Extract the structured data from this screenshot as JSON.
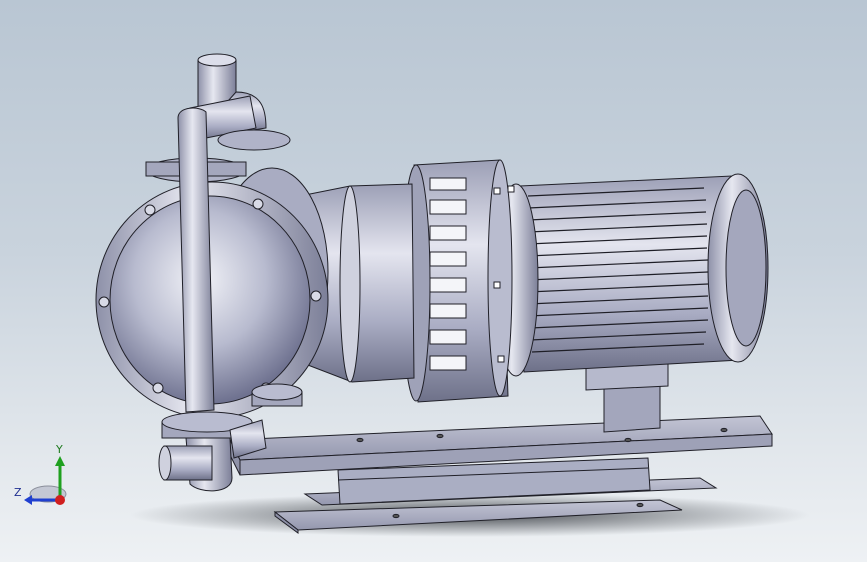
{
  "viewport": {
    "background_top": "#b9c6d3",
    "background_bottom": "#eef1f4",
    "model_color": "#b5b8cc",
    "model_edge_color": "#202028"
  },
  "triad": {
    "x_label": "",
    "y_label": "Y",
    "z_label": "Z",
    "y_color": "#1fa01f",
    "z_color": "#1f3fd0",
    "x_color": "#d01f1f"
  }
}
